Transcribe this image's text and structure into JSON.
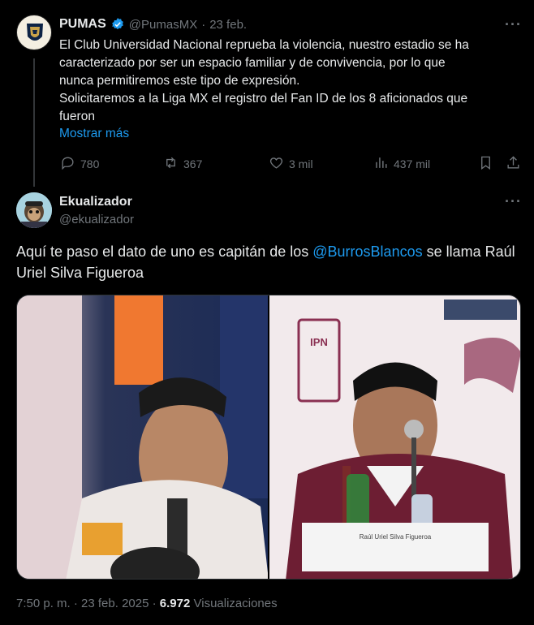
{
  "parent_tweet": {
    "name": "PUMAS",
    "handle": "@PumasMX",
    "separator": "·",
    "date": "23 feb.",
    "text": "El Club Universidad Nacional reprueba la violencia, nuestro estadio se ha\ncaracterizado por ser un espacio familiar y de convivencia, por lo que\nnunca  permitiremos este tipo de expresión.\nSolicitaremos a la Liga MX el registro del Fan ID de los 8 aficionados que\nfueron",
    "show_more": "Mostrar más",
    "replies": "780",
    "reposts": "367",
    "likes": "3 mil",
    "views": "437 mil",
    "more_menu": "···"
  },
  "reply": {
    "name": "Ekualizador",
    "handle": "@ekualizador",
    "more_menu": "···",
    "text_before": "Aquí te paso el dato de uno es capitán de los ",
    "mention": "@BurrosBlancos",
    "text_after": " se llama Raúl Uriel Silva Figueroa",
    "photo_right_logo": "IPN",
    "photo_right_placard": "Raúl Uriel Silva Figueroa",
    "timestamp": "7:50 p. m. · 23 feb. 2025 ·",
    "views_count": "6.972",
    "views_label": "Visualizaciones"
  },
  "colors": {
    "background": "#000000",
    "text": "#e7e9ea",
    "muted": "#71767b",
    "link": "#1d9bf0",
    "verified": "#1d9bf0"
  },
  "icons": [
    "reply-icon",
    "repost-icon",
    "like-icon",
    "views-icon",
    "bookmark-icon",
    "share-icon",
    "verified-badge-icon",
    "more-icon"
  ]
}
